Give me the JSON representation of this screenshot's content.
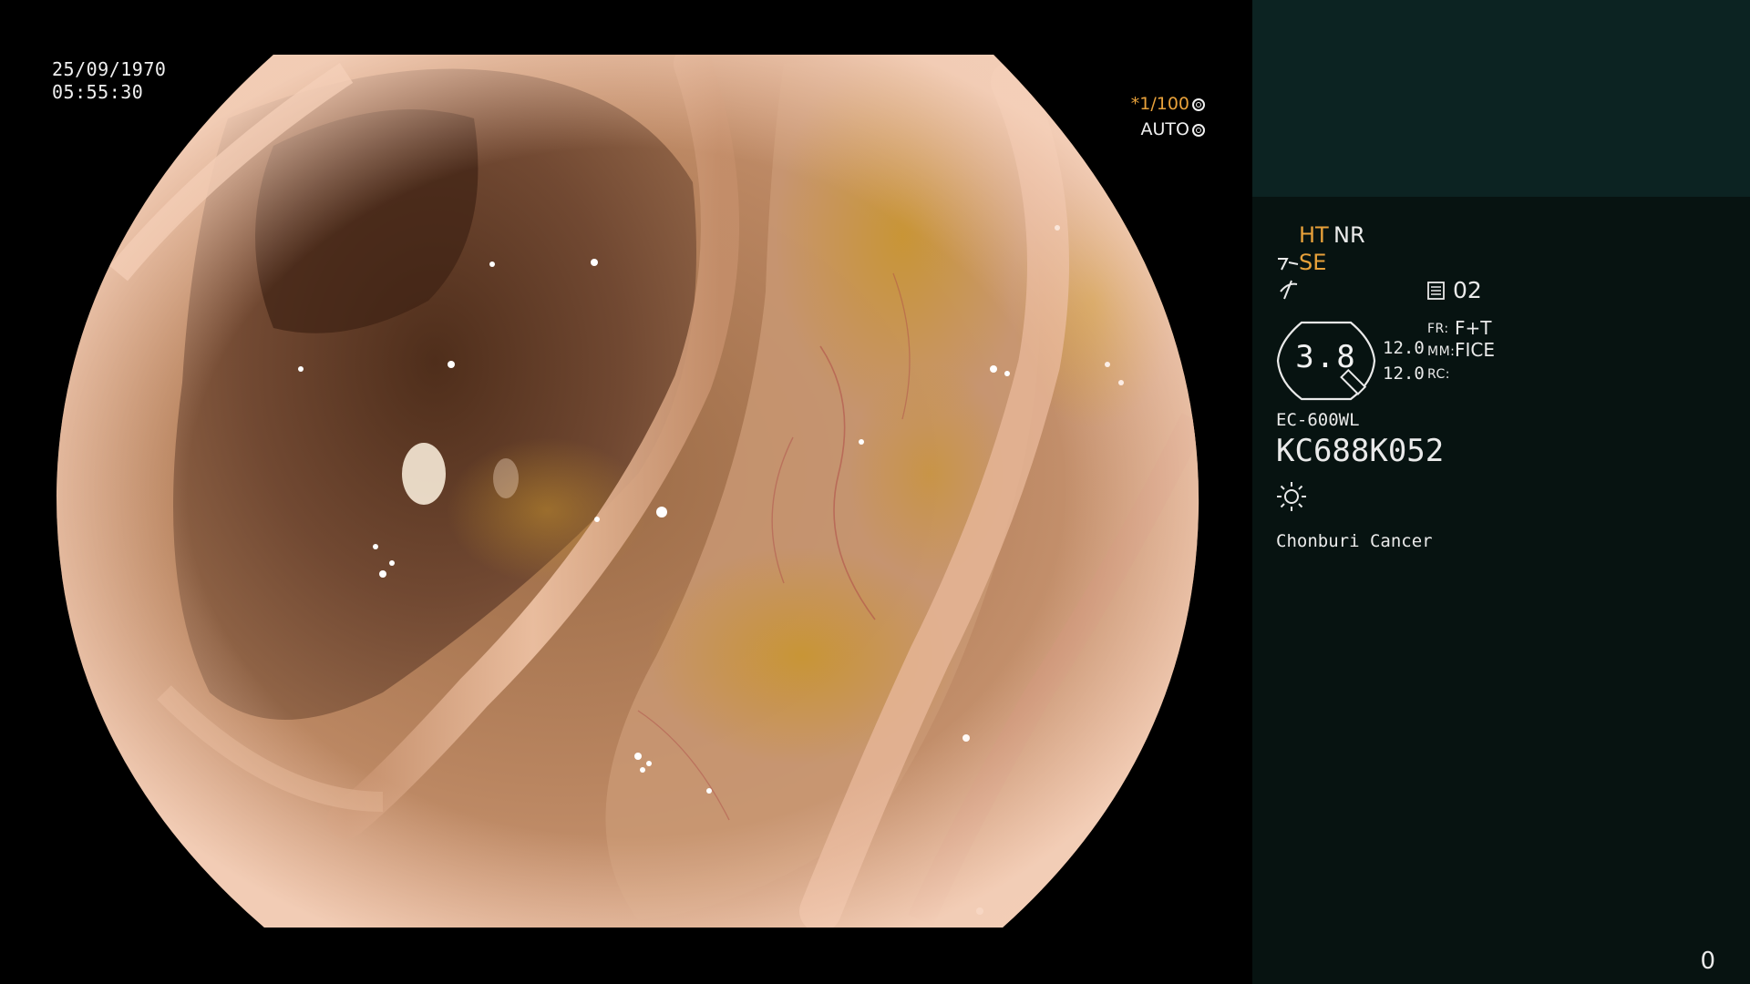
{
  "overlay": {
    "date": "25/09/1970",
    "time": "05:55:30",
    "shutter": "*1/100",
    "exposure_mode": "AUTO",
    "shutter_icon": "aperture-icon",
    "mode_icon": "iris-icon"
  },
  "panel": {
    "ht_label": "HT",
    "nr_label": "NR",
    "se_label": "SE",
    "enhance_icon": "enhance-icon",
    "structure_icon": "structure-icon",
    "memory_icon": "memory-icon",
    "memory_index": "02",
    "zoom_value": "3.8",
    "zoom_icon": "zoom-ring-icon",
    "value_upper": "12.0",
    "value_lower": "12.0",
    "fr_label": "FR:",
    "fr_value": "F+T",
    "mm_label": "MM:",
    "mm_value": "FICE",
    "rc_label": "RC:",
    "rc_value": "",
    "scope_model": "EC-600WL",
    "scope_serial": "KC688K052",
    "light_icon": "light-source-icon",
    "institution": "Chonburi Cancer",
    "frame_counter": "0"
  },
  "colors": {
    "accent_orange": "#e8a13a",
    "panel_bg": "#071311",
    "panel_top_bg": "#0c2322"
  }
}
